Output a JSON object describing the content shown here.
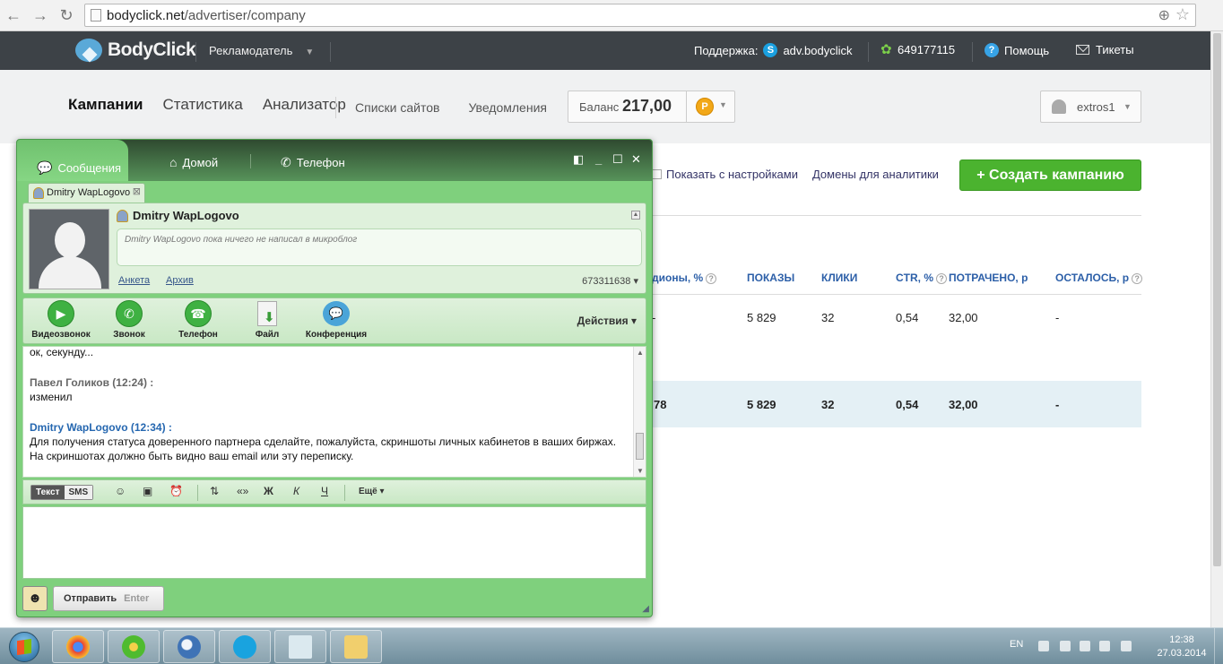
{
  "browser": {
    "back": "←",
    "forward": "→",
    "reload": "↻",
    "url_host": "bodyclick.net",
    "url_path": "/advertiser/company"
  },
  "site": {
    "logo_text": "BodyClick",
    "role": "Рекламодатель",
    "support_label": "Поддержка:",
    "skype": "adv.bodyclick",
    "icq": "649177115",
    "help": "Помощь",
    "tickets": "Тикеты",
    "nav": [
      "Кампании",
      "Статистика",
      "Анализатор"
    ],
    "secondary_nav": [
      "Списки сайтов",
      "Уведомления"
    ],
    "balance_label": "Баланс",
    "balance_value": "217,00",
    "currency_symbol": "Р",
    "username": "extros1",
    "show_with_settings": "Показать с настройками",
    "analytics_domains": "Домены для аналитики",
    "create_campaign": "+ Создать кампанию",
    "accent_green": "#4bb32f",
    "header_bg": "#3d4247"
  },
  "table": {
    "headers": [
      "дионы, %",
      "ПОКАЗЫ",
      "КЛИКИ",
      "CTR, %",
      "ПОТРАЧЕНО, р",
      "ОСТАЛОСЬ, р"
    ],
    "row": [
      "-",
      "5 829",
      "32",
      "0,54",
      "32,00",
      "-"
    ],
    "total": [
      "78",
      "5 829",
      "32",
      "0,54",
      "32,00",
      "-"
    ]
  },
  "messenger": {
    "tabs": [
      "Сообщения",
      "Домой",
      "Телефон"
    ],
    "contact_tab": "Dmitry WapLogovo",
    "contact_name": "Dmitry WapLogovo",
    "microblog": "Dmitry WapLogovo пока ничего не написал в микроблог",
    "profile_link": "Анкета",
    "archive_link": "Архив",
    "uin": "673311638",
    "actions": [
      "Видеозвонок",
      "Звонок",
      "Телефон",
      "Файл",
      "Конференция"
    ],
    "actions_menu": "Действия",
    "messages": [
      {
        "author": "",
        "text": "ок, секунду..."
      },
      {
        "author": "Павел Голиков (12:24) :",
        "text": "изменил"
      },
      {
        "author": "Dmitry WapLogovo (12:34) :",
        "text": "Для получения статуса доверенного партнера сделайте, пожалуйста, скриншоты личных кабинетов в ваших биржах. На скриншотах должно быть видно ваш email или эту переписку."
      }
    ],
    "mode_text": "Текст",
    "mode_sms": "SMS",
    "format_quote": "«»",
    "format_bold": "Ж",
    "format_italic": "К",
    "format_underline": "Ч",
    "more": "Ещё",
    "send": "Отправить",
    "send_key": "Enter"
  },
  "taskbar": {
    "lang": "EN",
    "time": "12:38",
    "date": "27.03.2014"
  }
}
